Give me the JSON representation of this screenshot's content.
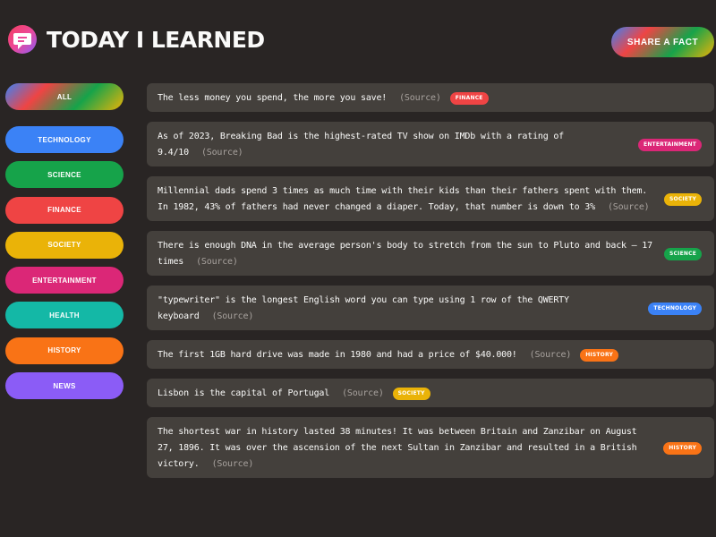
{
  "app": {
    "title": "TODAY I LEARNED",
    "share_label": "SHARE A FACT"
  },
  "categories": [
    {
      "label": "ALL",
      "color": "gradient"
    },
    {
      "label": "TECHNOLOGY",
      "color": "#3b82f6"
    },
    {
      "label": "SCIENCE",
      "color": "#16a34a"
    },
    {
      "label": "FINANCE",
      "color": "#ef4444"
    },
    {
      "label": "SOCIETY",
      "color": "#eab308"
    },
    {
      "label": "ENTERTAINMENT",
      "color": "#db2777"
    },
    {
      "label": "HEALTH",
      "color": "#14b8a6"
    },
    {
      "label": "HISTORY",
      "color": "#f97316"
    },
    {
      "label": "NEWS",
      "color": "#8b5cf6"
    }
  ],
  "facts": [
    {
      "text": "The less money you spend, the more you save!",
      "source": "(Source)",
      "tag": "FINANCE",
      "tag_color": "#ef4444"
    },
    {
      "text": "As of 2023, Breaking Bad is the highest-rated TV show on IMDb with a rating of 9.4/10",
      "source": "(Source)",
      "tag": "ENTERTAINMENT",
      "tag_color": "#db2777"
    },
    {
      "text": "Millennial dads spend 3 times as much time with their kids than their fathers spent with them. In 1982, 43% of fathers had never changed a diaper. Today, that number is down to 3%",
      "source": "(Source)",
      "tag": "SOCIETY",
      "tag_color": "#eab308"
    },
    {
      "text": "There is enough DNA in the average person's body to stretch from the sun to Pluto and back — 17 times",
      "source": "(Source)",
      "tag": "SCIENCE",
      "tag_color": "#16a34a"
    },
    {
      "text": "\"typewriter\" is the longest English word you can type using 1 row of the QWERTY keyboard",
      "source": "(Source)",
      "tag": "TECHNOLOGY",
      "tag_color": "#3b82f6"
    },
    {
      "text": "The first 1GB hard drive was made in 1980 and had a price of $40.000!",
      "source": "(Source)",
      "tag": "HISTORY",
      "tag_color": "#f97316"
    },
    {
      "text": "Lisbon is the capital of Portugal",
      "source": "(Source)",
      "tag": "SOCIETY",
      "tag_color": "#eab308"
    },
    {
      "text": "The shortest war in history lasted 38 minutes! It was between Britain and Zanzibar on August 27, 1896. It was over the ascension of the next Sultan in Zanzibar and resulted in a British victory.",
      "source": "(Source)",
      "tag": "HISTORY",
      "tag_color": "#f97316"
    }
  ]
}
